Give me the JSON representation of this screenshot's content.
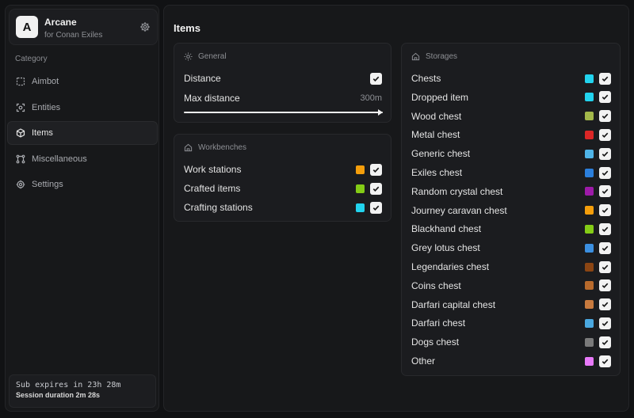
{
  "brand": {
    "logo_letter": "A",
    "title": "Arcane",
    "subtitle": "for Conan Exiles"
  },
  "sidebar": {
    "category_label": "Category",
    "items": [
      {
        "label": "Aimbot",
        "icon": "crosshair-square-icon",
        "active": false
      },
      {
        "label": "Entities",
        "icon": "target-icon",
        "active": false
      },
      {
        "label": "Items",
        "icon": "cube-icon",
        "active": true
      },
      {
        "label": "Miscellaneous",
        "icon": "nodes-icon",
        "active": false
      },
      {
        "label": "Settings",
        "icon": "gear-icon",
        "active": false
      }
    ],
    "subscription": {
      "expires": "Sub expires in 23h 28m",
      "session": "Session duration  2m 28s"
    }
  },
  "main": {
    "title": "Items",
    "general": {
      "title": "General",
      "distance_label": "Distance",
      "distance_checked": true,
      "max_distance_label": "Max distance",
      "max_distance_value": "300m",
      "max_distance_fraction": 1.0
    },
    "workbenches": {
      "title": "Workbenches",
      "rows": [
        {
          "label": "Work stations",
          "color": "#f59e0b",
          "checked": true
        },
        {
          "label": "Crafted items",
          "color": "#84cc16",
          "checked": true
        },
        {
          "label": "Crafting stations",
          "color": "#22d3ee",
          "checked": true
        }
      ]
    },
    "storages": {
      "title": "Storages",
      "rows": [
        {
          "label": "Chests",
          "color": "#22d3ee",
          "checked": true
        },
        {
          "label": "Dropped item",
          "color": "#22d3ee",
          "checked": true
        },
        {
          "label": "Wood chest",
          "color": "#a3b84a",
          "checked": true
        },
        {
          "label": "Metal chest",
          "color": "#dc2626",
          "checked": true
        },
        {
          "label": "Generic chest",
          "color": "#4fb4e8",
          "checked": true
        },
        {
          "label": "Exiles chest",
          "color": "#2b7fdc",
          "checked": true
        },
        {
          "label": "Random crystal chest",
          "color": "#9d1aa8",
          "checked": true
        },
        {
          "label": "Journey caravan chest",
          "color": "#f59e0b",
          "checked": true
        },
        {
          "label": "Blackhand chest",
          "color": "#84cc16",
          "checked": true
        },
        {
          "label": "Grey lotus chest",
          "color": "#3b8fe0",
          "checked": true
        },
        {
          "label": "Legendaries chest",
          "color": "#8b4513",
          "checked": true
        },
        {
          "label": "Coins chest",
          "color": "#b86a2c",
          "checked": true
        },
        {
          "label": "Darfari capital chest",
          "color": "#c87a3e",
          "checked": true
        },
        {
          "label": "Darfari chest",
          "color": "#4aa8e0",
          "checked": true
        },
        {
          "label": "Dogs chest",
          "color": "#7a7a7a",
          "checked": true
        },
        {
          "label": "Other",
          "color": "#e879f9",
          "checked": true
        }
      ]
    }
  }
}
